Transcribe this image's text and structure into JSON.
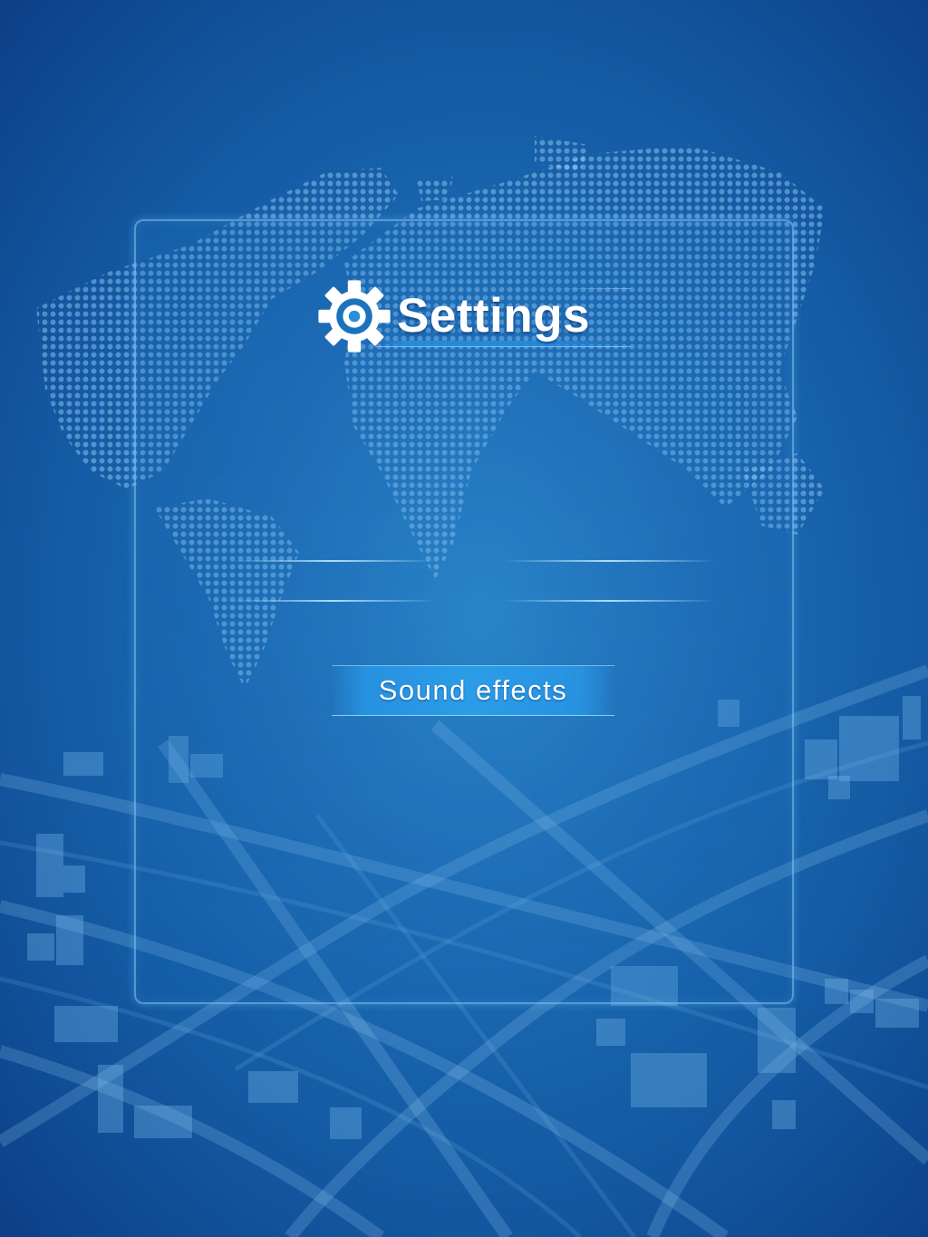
{
  "settings": {
    "title": "Settings",
    "title_icon": "gear-icon",
    "sound_effects_label": "Sound effects"
  },
  "colors": {
    "background": "#1c6bb3",
    "panel_border": "#8cc8f5",
    "button": "#2d9feb",
    "text": "#ffffff"
  }
}
